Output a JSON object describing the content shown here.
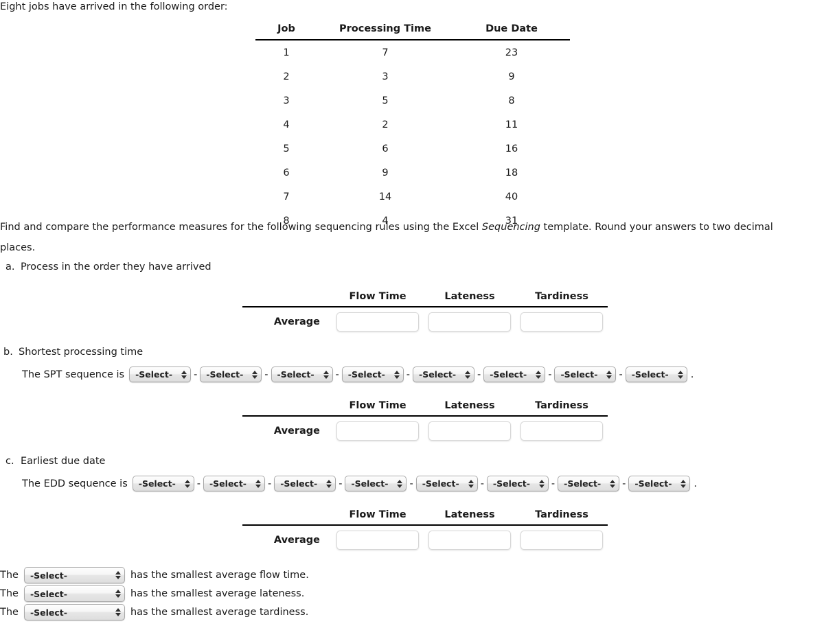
{
  "intro": "Eight jobs have arrived in the following order:",
  "job_table": {
    "headers": [
      "Job",
      "Processing Time",
      "Due Date"
    ],
    "rows": [
      [
        "1",
        "7",
        "23"
      ],
      [
        "2",
        "3",
        "9"
      ],
      [
        "3",
        "5",
        "8"
      ],
      [
        "4",
        "2",
        "11"
      ],
      [
        "5",
        "6",
        "16"
      ],
      [
        "6",
        "9",
        "18"
      ],
      [
        "7",
        "14",
        "40"
      ],
      [
        "8",
        "4",
        "31"
      ]
    ]
  },
  "instructions": {
    "part1": "Find and compare the performance measures for the following sequencing rules using the Excel ",
    "emphasis": "Sequencing",
    "part2": " template. Round your answers to two decimal places."
  },
  "items": {
    "a": {
      "marker": "a.",
      "text": "Process in the order they have arrived"
    },
    "b": {
      "marker": "b.",
      "text": "Shortest processing time"
    },
    "c": {
      "marker": "c.",
      "text": "Earliest due date"
    }
  },
  "sequences": {
    "spt": {
      "label": "The SPT sequence is",
      "selects": [
        "-Select-",
        "-Select-",
        "-Select-",
        "-Select-",
        "-Select-",
        "-Select-",
        "-Select-",
        "-Select-"
      ],
      "separator": "-",
      "terminator": "."
    },
    "edd": {
      "label": "The EDD sequence is",
      "selects": [
        "-Select-",
        "-Select-",
        "-Select-",
        "-Select-",
        "-Select-",
        "-Select-",
        "-Select-",
        "-Select-"
      ],
      "separator": "-",
      "terminator": "."
    }
  },
  "measure_table": {
    "headers": [
      "Flow Time",
      "Lateness",
      "Tardiness"
    ],
    "row_label": "Average",
    "values": [
      "",
      "",
      ""
    ],
    "placeholder": ""
  },
  "conclusions": [
    {
      "pre": "The",
      "select": "-Select-",
      "post": "has the smallest average flow time."
    },
    {
      "pre": "The",
      "select": "-Select-",
      "post": "has the smallest average lateness."
    },
    {
      "pre": "The",
      "select": "-Select-",
      "post": "has the smallest average tardiness."
    }
  ]
}
